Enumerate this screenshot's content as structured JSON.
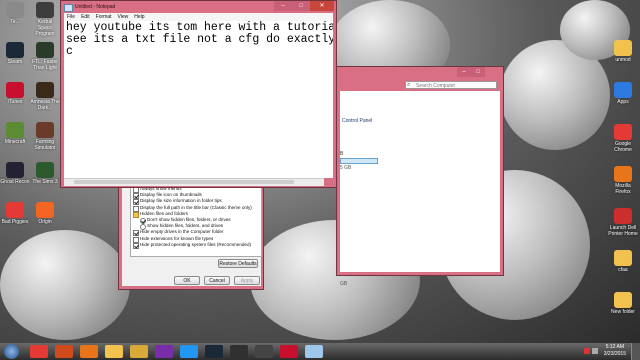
{
  "desktop": {
    "left_icons": [
      {
        "label": "Te...",
        "name": "desktop-icon-te",
        "color": "#8a8a8a"
      },
      {
        "label": "Kerbal Space Program",
        "name": "desktop-icon-kerbal",
        "color": "#3d3d3d"
      },
      {
        "label": "Steam",
        "name": "desktop-icon-steam",
        "color": "#1b2838"
      },
      {
        "label": "FTL: Faster Than Light",
        "name": "desktop-icon-ftl",
        "color": "#2a3b2a"
      },
      {
        "label": "iTunes",
        "name": "desktop-icon-itunes",
        "color": "#c8102e"
      },
      {
        "label": "Amnesia The Dark...",
        "name": "desktop-icon-amnesia",
        "color": "#3a2a1a"
      },
      {
        "label": "Minecraft",
        "name": "desktop-icon-minecraft",
        "color": "#5b8c32"
      },
      {
        "label": "Farming Simulator",
        "name": "desktop-icon-farming",
        "color": "#6b3b2a"
      },
      {
        "label": "Ghost Recon",
        "name": "desktop-icon-ghostrecon",
        "color": "#223"
      },
      {
        "label": "The Sims 3",
        "name": "desktop-icon-sims",
        "color": "#2c5a2c"
      },
      {
        "label": "Bad Piggies",
        "name": "desktop-icon-badpiggies",
        "color": "#e53935"
      },
      {
        "label": "Origin",
        "name": "desktop-icon-origin",
        "color": "#f26522"
      }
    ],
    "right_icons": [
      {
        "label": "unmod",
        "name": "desktop-icon-unmod",
        "color": "#f2c24f"
      },
      {
        "label": "Apps",
        "name": "desktop-icon-apps",
        "color": "#2d7be0"
      },
      {
        "label": "Google Chrome",
        "name": "desktop-icon-chrome",
        "color": "#e53935"
      },
      {
        "label": "Mozilla Firefox",
        "name": "desktop-icon-firefox",
        "color": "#e8751a"
      },
      {
        "label": "Launch Dell Printer Home",
        "name": "desktop-icon-dell-printer",
        "color": "#cc2d2d"
      },
      {
        "label": "cfaa",
        "name": "desktop-icon-cfaa",
        "color": "#f2c24f"
      },
      {
        "label": "New folder",
        "name": "desktop-icon-new-folder",
        "color": "#f2c24f"
      }
    ]
  },
  "notepad": {
    "title": "Untitled - Notepad",
    "menu": [
      "File",
      "Edit",
      "Format",
      "View",
      "Help"
    ],
    "content": "hey youtube its tom here with a tutorial\nsee its a txt file not a cfg do exactly w\nc",
    "minimize_glyph": "–",
    "maximize_glyph": "□",
    "close_glyph": "✕"
  },
  "control_panel": {
    "address_tail": "Control Panel",
    "search_placeholder": "Search Computer",
    "fragment_b": "B",
    "fragment_sb": "5 GB",
    "fragment_gb": "GB"
  },
  "folder_options": {
    "options": [
      {
        "label": "Always show menus",
        "checked": false,
        "level": 1
      },
      {
        "label": "Display file icon on thumbnails",
        "checked": true,
        "level": 1
      },
      {
        "label": "Display file size information in folder tips",
        "checked": true,
        "level": 1
      },
      {
        "label": "Display the full path in the title bar (Classic theme only)",
        "checked": false,
        "level": 1
      },
      {
        "label": "Hidden files and folders",
        "checked": null,
        "level": 1
      },
      {
        "label": "Don't show hidden files, folders, or drives",
        "checked": true,
        "level": 2
      },
      {
        "label": "Show hidden files, folders, and drives",
        "checked": false,
        "level": 2
      },
      {
        "label": "Hide empty drives in the Computer folder",
        "checked": true,
        "level": 1
      },
      {
        "label": "Hide extensions for known file types",
        "checked": false,
        "level": 1
      },
      {
        "label": "Hide protected operating system files (Recommended)",
        "checked": true,
        "level": 1
      }
    ],
    "restore_defaults_label": "Restore Defaults",
    "ok_label": "OK",
    "cancel_label": "Cancel",
    "apply_label": "Apply"
  },
  "taskbar": {
    "start_label": "start",
    "items": [
      {
        "name": "taskbar-chrome",
        "color": "#e53935"
      },
      {
        "name": "taskbar-media",
        "color": "#d04a1c"
      },
      {
        "name": "taskbar-firefox",
        "color": "#e8751a"
      },
      {
        "name": "taskbar-explorer",
        "color": "#f2c24f"
      },
      {
        "name": "taskbar-folder",
        "color": "#d9a93a"
      },
      {
        "name": "taskbar-app",
        "color": "#7a2da8"
      },
      {
        "name": "taskbar-skype",
        "color": "#2196f3"
      },
      {
        "name": "taskbar-steam",
        "color": "#1b2838"
      },
      {
        "name": "taskbar-game",
        "color": "#303030"
      },
      {
        "name": "taskbar-obs",
        "color": "#444444"
      },
      {
        "name": "taskbar-itunes",
        "color": "#c8102e"
      },
      {
        "name": "taskbar-notepad",
        "color": "#9ec7ea"
      }
    ],
    "clock_time": "5:12 AM",
    "clock_date": "3/23/2015"
  }
}
